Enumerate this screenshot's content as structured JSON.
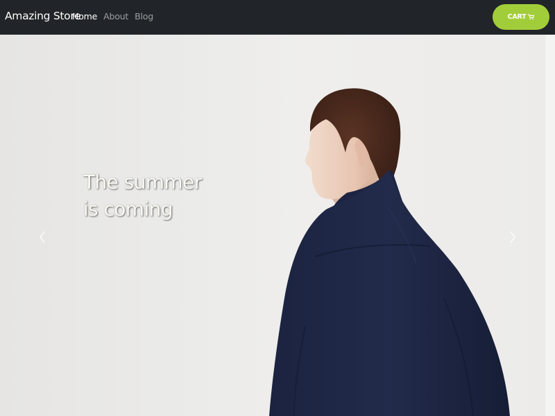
{
  "navbar": {
    "brand": "Amazing Store",
    "links": [
      {
        "label": "Home",
        "active": true
      },
      {
        "label": "About",
        "active": false
      },
      {
        "label": "Blog",
        "active": false
      }
    ],
    "cart_label": "CART",
    "cart_icon": "shopping-cart-icon",
    "cart_color": "#a2cd3a",
    "background_color": "#212529"
  },
  "hero": {
    "caption": "The summer is coming",
    "prev_icon": "chevron-left-icon",
    "next_icon": "chevron-right-icon"
  }
}
